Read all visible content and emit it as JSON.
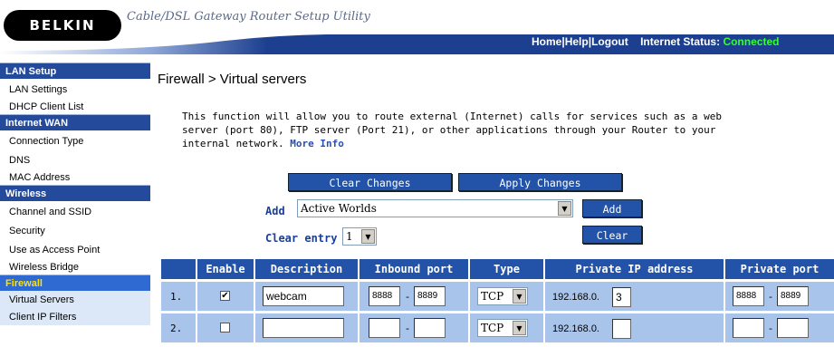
{
  "header": {
    "logo": "BELKIN",
    "app_title": "Cable/DSL Gateway Router Setup Utility",
    "links": [
      "Home",
      "Help",
      "Logout"
    ],
    "status_label": "Internet Status:",
    "status_value": "Connected"
  },
  "sidebar": {
    "sections": [
      {
        "title": "LAN Setup",
        "items": [
          "LAN Settings",
          "DHCP Client List"
        ]
      },
      {
        "title": "Internet WAN",
        "items": [
          "Connection Type",
          "DNS",
          "MAC Address"
        ]
      },
      {
        "title": "Wireless",
        "items": [
          "Channel and SSID",
          "Security",
          "Use as Access Point",
          "Wireless Bridge"
        ]
      },
      {
        "title": "Firewall",
        "items": [
          "Virtual Servers",
          "Client IP Filters"
        ]
      }
    ]
  },
  "main": {
    "title": "Firewall > Virtual servers",
    "description": "This function will allow you to route external (Internet) calls for services such as a web server (port 80), FTP server (Port 21), or other applications through your Router to your internal network.",
    "more_info": "More Info",
    "clear_changes": "Clear Changes",
    "apply_changes": "Apply Changes",
    "add_label": "Add",
    "add_select_value": "Active Worlds",
    "add_button": "Add",
    "clear_entry_label": "Clear entry",
    "clear_entry_value": "1",
    "clear_button": "Clear"
  },
  "table": {
    "headers": [
      "Enable",
      "Description",
      "Inbound port",
      "Type",
      "Private IP address",
      "Private port"
    ],
    "rows": [
      {
        "num": "1.",
        "enabled": true,
        "description": "webcam",
        "in_from": "8888",
        "in_to": "8889",
        "type": "TCP",
        "ip_prefix": "192.168.0.",
        "ip_last": "3",
        "priv_from": "8888",
        "priv_to": "8889"
      },
      {
        "num": "2.",
        "enabled": false,
        "description": "",
        "in_from": "",
        "in_to": "",
        "type": "TCP",
        "ip_prefix": "192.168.0.",
        "ip_last": "",
        "priv_from": "",
        "priv_to": ""
      }
    ]
  }
}
